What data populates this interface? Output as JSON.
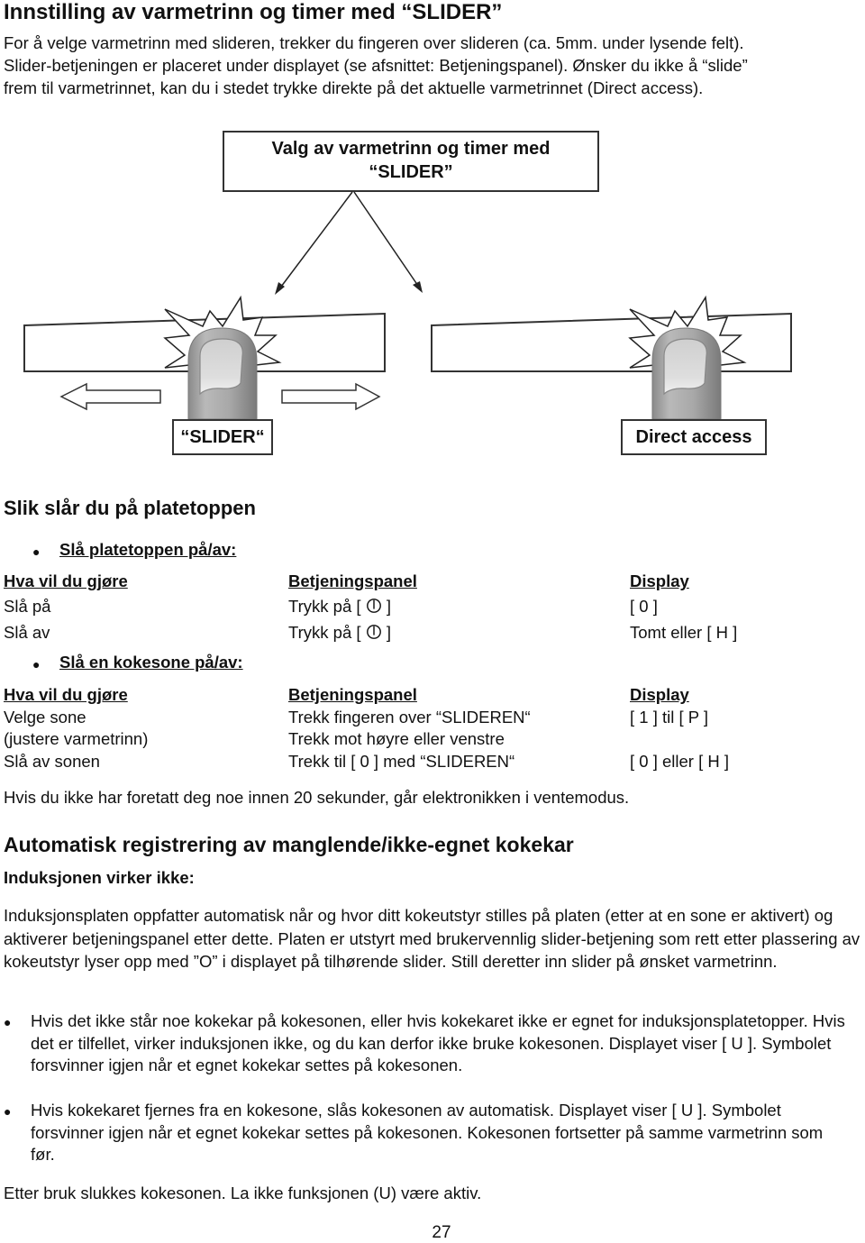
{
  "title": "Innstilling av varmetrinn og timer med “SLIDER”",
  "intro_lines": [
    "For å velge varmetrinn med slideren, trekker du fingeren over slideren (ca. 5mm. under lysende felt).",
    "Slider-betjeningen er placeret under displayet (se afsnittet: Betjeningspanel). Ønsker du ikke å “slide”",
    "frem til varmetrinnet, kan du i stedet trykke direkte på det aktuelle varmetrinnet (Direct access)."
  ],
  "diagram": {
    "top_box_line1": "Valg av varmetrinn og timer med",
    "top_box_line2": "“SLIDER”",
    "left_label": "“SLIDER“",
    "right_label": "Direct access",
    "icons": [
      "finger-press-icon",
      "starburst-icon",
      "arrow-left-icon",
      "arrow-right-icon",
      "arrow-down-icon"
    ]
  },
  "section_on": {
    "heading": "Slik slår du på platetoppen",
    "sub1": {
      "title": "Slå platetoppen på/av:",
      "headers": [
        "Hva vil du gjøre",
        "Betjeningspanel",
        "Display"
      ],
      "rows": [
        {
          "action": "Slå på",
          "panel_prefix": "Trykk på [",
          "panel_icon": "power-icon",
          "panel_suffix": "]",
          "display": "[ 0 ]"
        },
        {
          "action": "Slå av",
          "panel_prefix": "Trykk på [",
          "panel_icon": "power-icon",
          "panel_suffix": "]",
          "display": "Tomt eller [ H ]"
        }
      ]
    },
    "sub2": {
      "title": "Slå en kokesone på/av:",
      "headers": [
        "Hva vil du gjøre",
        "Betjeningspanel",
        "Display"
      ],
      "rows": [
        {
          "action": "Velge sone",
          "panel": "Trekk fingeren over “SLIDEREN“",
          "display": "[ 1 ] til [ P ]"
        },
        {
          "action": "(justere varmetrinn)",
          "panel": "Trekk mot høyre eller venstre",
          "display": ""
        },
        {
          "action": "Slå av sonen",
          "panel": "Trekk til [ 0 ] med “SLIDEREN“",
          "display": "[ 0 ] eller [ H ]"
        }
      ]
    },
    "note": "Hvis du ikke har foretatt deg noe innen 20 sekunder, går elektronikken i ventemodus."
  },
  "section_auto": {
    "heading": "Automatisk registrering av manglende/ikke-egnet kokekar",
    "subheading": "Induksjonen virker ikke:",
    "paragraph": "Induksjonsplaten oppfatter automatisk når og hvor ditt kokeutstyr stilles på platen (etter at en sone er aktivert) og aktiverer betjeningspanel etter dette.  Platen er utstyrt med brukervennlig slider-betjening som rett etter plassering av kokeutstyr lyser opp med ”O” i displayet på tilhørende slider. Still deretter inn slider på ønsket varmetrinn.",
    "bullets": [
      "Hvis det ikke står noe kokekar på kokesonen, eller hvis kokekaret ikke er egnet for induksjonsplatetopper. Hvis det er tilfellet, virker induksjonen ikke, og du kan derfor ikke bruke kokesonen. Displayet viser [ U ]. Symbolet forsvinner igjen når et egnet kokekar settes på kokesonen.",
      "Hvis kokekaret fjernes fra en kokesone, slås kokesonen av automatisk. Displayet viser [ U ]. Symbolet forsvinner igjen når et egnet kokekar settes på kokesonen. Kokesonen fortsetter på samme varmetrinn som før."
    ],
    "closing": "Etter bruk slukkes kokesonen. La ikke funksjonen (U) være aktiv."
  },
  "page_number": "27"
}
